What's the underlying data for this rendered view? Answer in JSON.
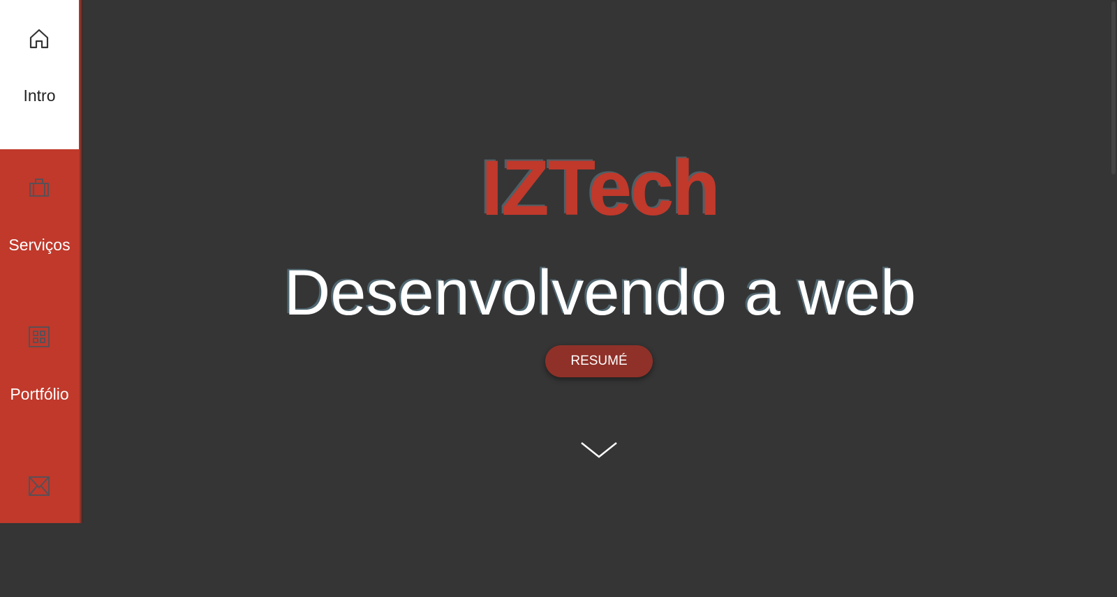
{
  "nav": {
    "items": [
      {
        "label": "Intro",
        "icon": "home-icon",
        "active": true
      },
      {
        "label": "Serviços",
        "icon": "briefcase-icon",
        "active": false
      },
      {
        "label": "Portfólio",
        "icon": "grid-icon",
        "active": false
      },
      {
        "label": "",
        "icon": "mail-icon",
        "active": false
      }
    ]
  },
  "hero": {
    "brand": "IZTech",
    "tagline": "Desenvolvendo a web",
    "button_label": "RESUMÉ",
    "scroll_icon": "chevron-down-icon"
  },
  "colors": {
    "accent": "#c0392b",
    "background": "#353535",
    "button": "#8f3128"
  }
}
